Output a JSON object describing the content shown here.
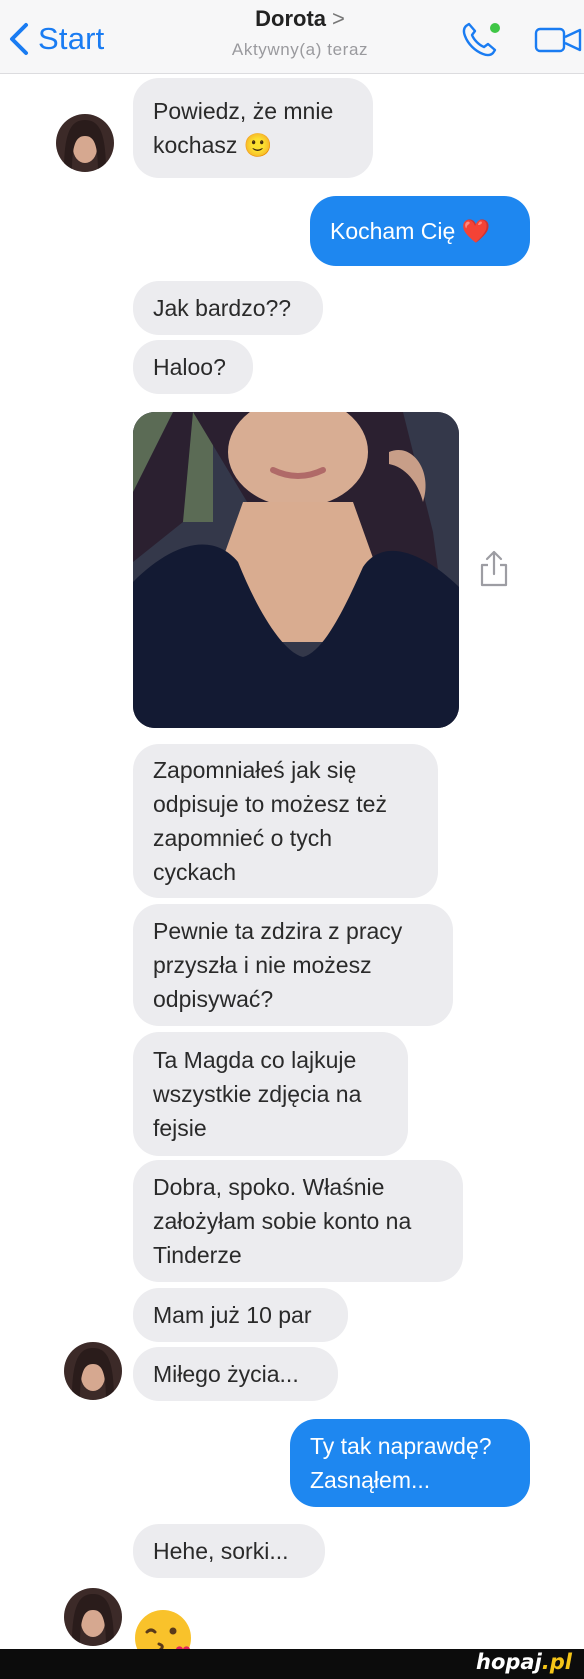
{
  "header": {
    "back_label": "Start",
    "contact_name": "Dorota",
    "contact_status": "Aktywny(a) teraz",
    "icons": {
      "back": "chevron-left-icon",
      "call": "phone-icon",
      "video": "video-camera-icon"
    }
  },
  "messages": {
    "m1": "Powiedz, że mnie\nkochasz 🙂",
    "m2": "Kocham Cię ❤️",
    "m3": "Jak bardzo??",
    "m4": "Haloo?",
    "m5": "Zapomniałeś jak się\nodpisuje to możesz też\nzapomnieć o tych\ncyckach",
    "m6": "Pewnie ta zdzira z pracy\nprzyszła i nie możesz\nodpisywać?",
    "m7": "Ta Magda co lajkuje\nwszystkie zdjęcia na\nfejsie",
    "m8": "Dobra, spoko. Właśnie\nzałożyłam sobie konto na\nTinderze",
    "m9": "Mam już 10 par",
    "m10": "Miłego życia...",
    "m11": "Ty tak naprawdę?\nZasnąłem...",
    "m12": "Hehe, sorki..."
  },
  "colors": {
    "accent": "#1e87f0",
    "incoming_bubble": "#ececef",
    "header_bg": "#f7f7f8"
  },
  "watermark": {
    "name": "hopaj",
    "tld": ".pl"
  }
}
